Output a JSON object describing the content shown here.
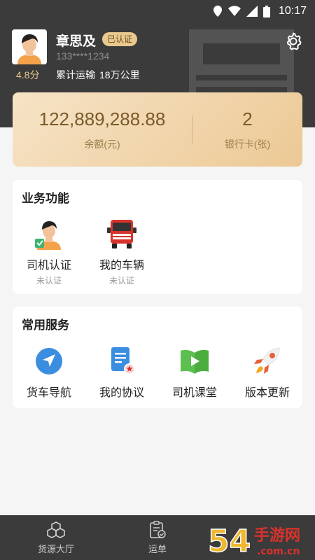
{
  "status": {
    "time": "10:17"
  },
  "profile": {
    "name": "章思及",
    "verified_badge": "已认证",
    "phone": "133****1234",
    "rating": "4.8分",
    "mileage_label": "累计运输",
    "mileage_value": "18万公里"
  },
  "balance": {
    "amount": "122,889,288.88",
    "amount_label": "余额(元)",
    "cards": "2",
    "cards_label": "银行卡(张)"
  },
  "business": {
    "title": "业务功能",
    "items": [
      {
        "label": "司机认证",
        "status": "未认证",
        "icon": "driver-icon"
      },
      {
        "label": "我的车辆",
        "status": "未认证",
        "icon": "truck-icon"
      }
    ]
  },
  "services": {
    "title": "常用服务",
    "items": [
      {
        "label": "货车导航",
        "icon": "navigation-icon"
      },
      {
        "label": "我的协议",
        "icon": "document-icon"
      },
      {
        "label": "司机课堂",
        "icon": "video-book-icon"
      },
      {
        "label": "版本更新",
        "icon": "rocket-icon"
      }
    ]
  },
  "tabbar": {
    "items": [
      {
        "label": "货源大厅",
        "icon": "cargo-icon"
      },
      {
        "label": "运单",
        "icon": "waybill-icon"
      }
    ]
  },
  "watermark": {
    "brand": "54",
    "text": "手游网",
    "domain": ".com.cn"
  },
  "colors": {
    "header_bg": "#3b3b3b",
    "gold": "#e9c98f",
    "card_gradient_start": "#f6e3c6",
    "card_gradient_end": "#ecc995",
    "nav_blue": "#3b8de0",
    "book_green": "#5cbf4f",
    "truck_red": "#d8322c"
  }
}
